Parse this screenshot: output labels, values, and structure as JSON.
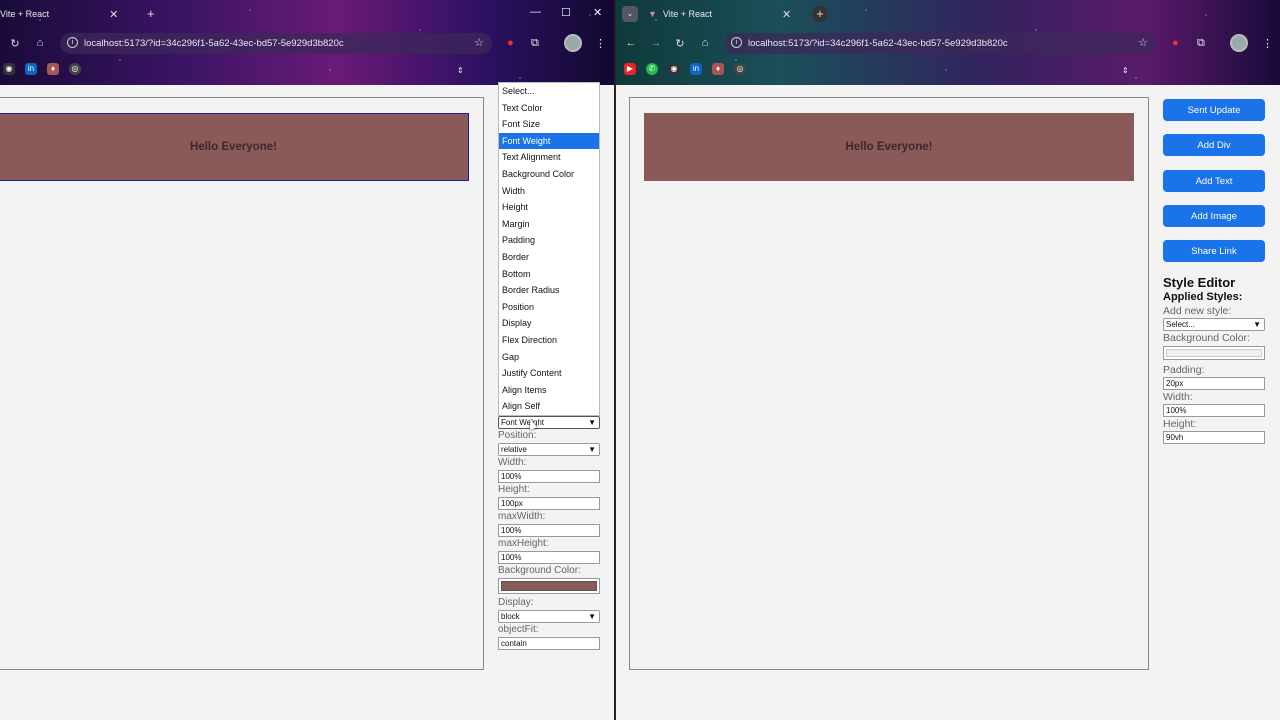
{
  "left_window": {
    "tab_title": "Vite + React",
    "url": "localhost:5173/?id=34c296f1-5a62-43ec-bd57-5e929d3b820c",
    "canvas_text": "Hello Everyone!",
    "dropdown_options": [
      "Select...",
      "Text Color",
      "Font Size",
      "Font Weight",
      "Text Alignment",
      "Background Color",
      "Width",
      "Height",
      "Margin",
      "Padding",
      "Border",
      "Bottom",
      "Border Radius",
      "Position",
      "Display",
      "Flex Direction",
      "Gap",
      "Justify Content",
      "Align Items",
      "Align Self"
    ],
    "dropdown_highlighted": "Font Weight",
    "style_select_value": "Font Weight",
    "props": {
      "position_label": "Position:",
      "position_value": "relative",
      "width_label": "Width:",
      "width_value": "100%",
      "height_label": "Height:",
      "height_value": "100px",
      "maxwidth_label": "maxWidth:",
      "maxwidth_value": "100%",
      "maxheight_label": "maxHeight:",
      "maxheight_value": "100%",
      "bg_label": "Background Color:",
      "bg_color": "#8a5a58",
      "display_label": "Display:",
      "display_value": "block",
      "objectfit_label": "objectFit:",
      "objectfit_value": "contain"
    }
  },
  "right_window": {
    "tab_title": "Vite + React",
    "url": "localhost:5173/?id=34c296f1-5a62-43ec-bd57-5e929d3b820c",
    "canvas_text": "Hello Everyone!",
    "buttons": {
      "sent_update": "Sent Update",
      "add_div": "Add Div",
      "add_text": "Add Text",
      "add_image": "Add Image",
      "share_link": "Share Link"
    },
    "style_editor": {
      "title": "Style Editor",
      "applied": "Applied Styles:",
      "add_new_label": "Add new style:",
      "add_new_value": "Select...",
      "bg_label": "Background Color:",
      "padding_label": "Padding:",
      "padding_value": "20px",
      "width_label": "Width:",
      "width_value": "100%",
      "height_label": "Height:",
      "height_value": "90vh"
    }
  },
  "colors": {
    "accent": "#1a73e8",
    "box": "#8a5a58"
  }
}
